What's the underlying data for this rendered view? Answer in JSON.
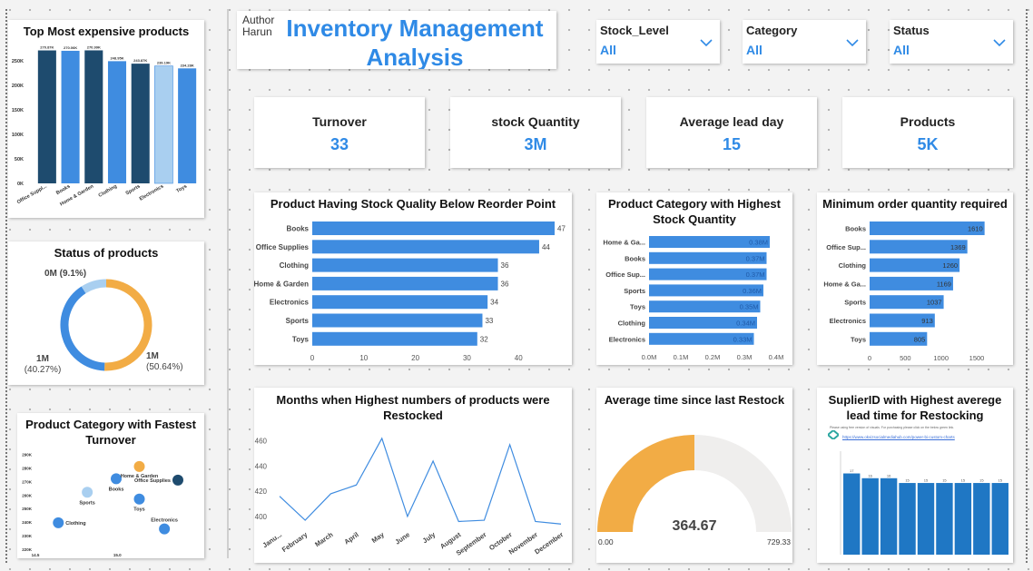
{
  "header": {
    "author_label": "Author",
    "author_name": "Harun",
    "title_line1": "Inventory Management",
    "title_line2": "Analysis"
  },
  "slicers": [
    {
      "label": "Stock_Level",
      "value": "All"
    },
    {
      "label": "Category",
      "value": "All"
    },
    {
      "label": "Status",
      "value": "All"
    }
  ],
  "kpis": [
    {
      "label": "Turnover",
      "value": "33"
    },
    {
      "label": "stock Quantity",
      "value": "3M"
    },
    {
      "label": "Average lead day",
      "value": "15"
    },
    {
      "label": "Products",
      "value": "5K"
    }
  ],
  "colors": {
    "accent": "#2f8ae6",
    "bar_blue": "#3f8ce0",
    "navy": "#1e4b6e",
    "light_blue": "#a9cff0",
    "orange": "#f2ac45",
    "gauge_bg": "#efeeed",
    "supplier_bar": "#1f77c4"
  },
  "top_expensive": {
    "title": "Top Most expensive products",
    "chart_data": {
      "type": "bar",
      "categories": [
        "Office Suppl...",
        "Books",
        "Home & Garden",
        "Clothing",
        "Sports",
        "Electronics",
        "Toys"
      ],
      "values": [
        270870,
        270060,
        270990,
        248950,
        243870,
        239190,
        234280
      ],
      "value_labels": [
        "270.87K",
        "270.06K",
        "270.99K",
        "248.95K",
        "243.87K",
        "239.19K",
        "234.28K"
      ],
      "y_ticks": [
        "0K",
        "50K",
        "100K",
        "150K",
        "200K",
        "250K"
      ],
      "ylim": [
        0,
        270000
      ],
      "bar_colors": [
        "#1e4b6e",
        "#3f8ce0",
        "#1e4b6e",
        "#3f8ce0",
        "#1e4b6e",
        "#a9cff0",
        "#3f8ce0"
      ]
    }
  },
  "status": {
    "title": "Status of products",
    "chart_data": {
      "type": "pie",
      "slices": [
        {
          "label": "1M (50.64%)",
          "value": 50.64,
          "color": "#f2ac45"
        },
        {
          "label": "1M (40.27%)",
          "value": 40.27,
          "color": "#3f8ce0"
        },
        {
          "label": "0M (9.1%)",
          "value": 9.1,
          "color": "#a9cff0"
        }
      ]
    }
  },
  "fastest_turnover": {
    "title": "Product Category with Fastest Turnover",
    "chart_data": {
      "type": "scatter",
      "points": [
        {
          "label": "Clothing",
          "x": 14.6,
          "y": 239500,
          "color": "#3f8ce0"
        },
        {
          "label": "Sports",
          "x": 14.75,
          "y": 262000,
          "color": "#a9cff0"
        },
        {
          "label": "Books",
          "x": 14.9,
          "y": 272000,
          "color": "#3f8ce0"
        },
        {
          "label": "Home & Garden",
          "x": 15.02,
          "y": 281000,
          "color": "#f2ac45"
        },
        {
          "label": "Office Supplies",
          "x": 15.22,
          "y": 271000,
          "color": "#1e4b6e"
        },
        {
          "label": "Toys",
          "x": 15.02,
          "y": 257000,
          "color": "#3f8ce0"
        },
        {
          "label": "Electronics",
          "x": 15.15,
          "y": 235000,
          "color": "#3f8ce0"
        }
      ],
      "y_ticks": [
        "220K",
        "230K",
        "240K",
        "250K",
        "260K",
        "270K",
        "280K",
        "290K"
      ],
      "x_ticks": [
        "14.5",
        "15.0"
      ]
    }
  },
  "below_reorder": {
    "title": "Product Having Stock Quality Below Reorder Point",
    "chart_data": {
      "type": "bar",
      "orientation": "horizontal",
      "categories": [
        "Books",
        "Office Supplies",
        "Clothing",
        "Home & Garden",
        "Electronics",
        "Sports",
        "Toys"
      ],
      "values": [
        47,
        44,
        36,
        36,
        34,
        33,
        32
      ],
      "x_ticks": [
        "0",
        "10",
        "20",
        "30",
        "40"
      ],
      "xlim": [
        0,
        47
      ]
    }
  },
  "highest_stock": {
    "title_line1": "Product Category with Highest",
    "title_line2": "Stock Quantity",
    "chart_data": {
      "type": "bar",
      "orientation": "horizontal",
      "categories": [
        "Home & Ga...",
        "Books",
        "Office Sup...",
        "Sports",
        "Toys",
        "Clothing",
        "Electronics"
      ],
      "values": [
        0.38,
        0.37,
        0.37,
        0.36,
        0.35,
        0.34,
        0.33
      ],
      "value_labels": [
        "0.38M",
        "0.37M",
        "0.37M",
        "0.36M",
        "0.35M",
        "0.34M",
        "0.33M"
      ],
      "x_ticks": [
        "0.0M",
        "0.1M",
        "0.2M",
        "0.3M",
        "0.4M"
      ],
      "xlim": [
        0,
        0.4
      ]
    }
  },
  "min_order": {
    "title": "Minimum order quantity required",
    "chart_data": {
      "type": "bar",
      "orientation": "horizontal",
      "categories": [
        "Books",
        "Office Sup...",
        "Clothing",
        "Home & Ga...",
        "Sports",
        "Electronics",
        "Toys"
      ],
      "values": [
        1610,
        1369,
        1260,
        1169,
        1037,
        913,
        805
      ],
      "value_labels": [
        "1610",
        "1369",
        "1260",
        "1169",
        "1037",
        "913",
        "805"
      ],
      "x_ticks": [
        "0",
        "500",
        "1000",
        "1500"
      ],
      "xlim": [
        0,
        1500
      ]
    }
  },
  "months_restock": {
    "title_line1": "Months when Highest numbers of products were",
    "title_line2": "Restocked",
    "chart_data": {
      "type": "line",
      "categories": [
        "Janu...",
        "February",
        "March",
        "April",
        "May",
        "June",
        "July",
        "August",
        "September",
        "October",
        "November",
        "December"
      ],
      "values": [
        416,
        397,
        418,
        425,
        462,
        400,
        444,
        396,
        397,
        457,
        396,
        394
      ],
      "y_ticks": [
        "400",
        "420",
        "440",
        "460"
      ],
      "ylim": [
        392,
        467
      ]
    }
  },
  "avg_restock": {
    "title": "Average time since last Restock",
    "value_label": "364.67",
    "min_label": "0.00",
    "max_label": "729.33",
    "value": 364.67,
    "max": 729.33
  },
  "supplier_lead": {
    "title_line1": "SuplierID with Highest averege",
    "title_line2": "lead time for Restocking",
    "note": "Please using free version of visuals. For purchasing please click on the below green link.",
    "link": "https://www.okvizsocialmediahub.com/power-bi-custom-charts",
    "chart_data": {
      "type": "bar",
      "values": [
        17,
        16,
        16,
        15,
        15,
        15,
        15,
        15,
        15
      ],
      "value_labels": [
        "17",
        "16",
        "16",
        "15",
        "15",
        "15",
        "15",
        "15",
        "15"
      ],
      "ylim": [
        0,
        19
      ]
    }
  }
}
